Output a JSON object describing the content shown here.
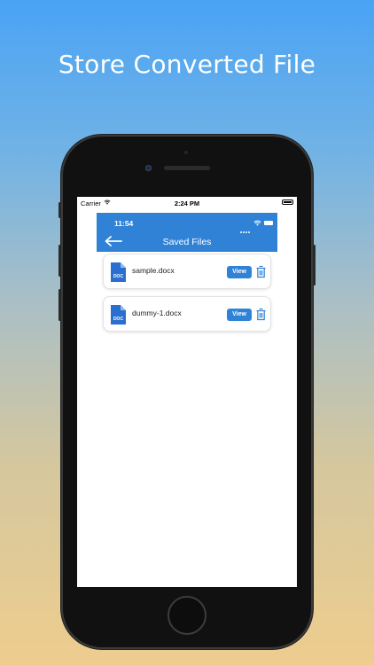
{
  "headline": "Store Converted File",
  "device_status_bar": {
    "carrier": "Carrier",
    "time": "2:24 PM"
  },
  "app": {
    "inner_status_time": "11:54",
    "header_title": "Saved Files",
    "accent_color": "#2f82d6",
    "files": [
      {
        "name": "sample.docx",
        "icon": "doc-file-icon",
        "badge": "DOC",
        "view_label": "View",
        "delete_icon": "trash-icon"
      },
      {
        "name": "dummy-1.docx",
        "icon": "doc-file-icon",
        "badge": "DOC",
        "view_label": "View",
        "delete_icon": "trash-icon"
      }
    ]
  }
}
